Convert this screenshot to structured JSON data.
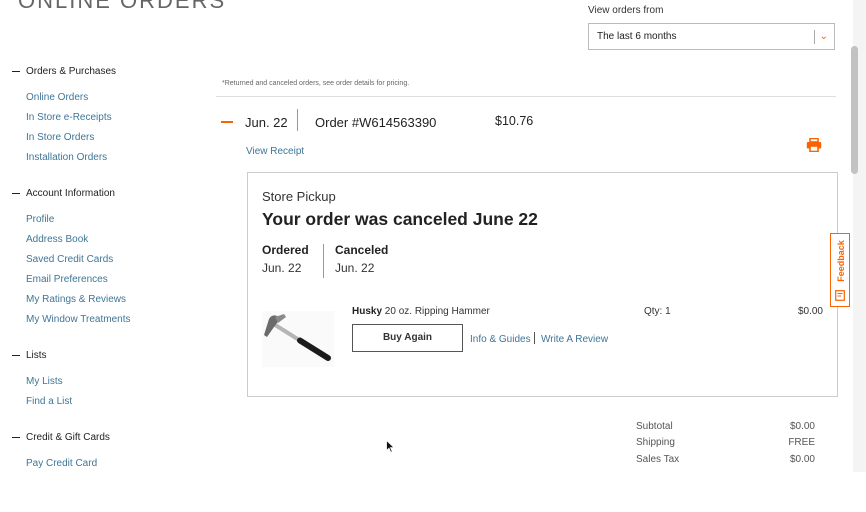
{
  "sidebar": {
    "sections": [
      {
        "title": "Orders & Purchases",
        "items": [
          "Online Orders",
          "In Store e-Receipts",
          "In Store Orders",
          "Installation Orders"
        ]
      },
      {
        "title": "Account Information",
        "items": [
          "Profile",
          "Address Book",
          "Saved Credit Cards",
          "Email Preferences",
          "My Ratings & Reviews",
          "My Window Treatments"
        ]
      },
      {
        "title": "Lists",
        "items": [
          "My Lists",
          "Find a List"
        ]
      },
      {
        "title": "Credit & Gift Cards",
        "items": [
          "Pay Credit Card"
        ]
      }
    ]
  },
  "filter": {
    "label": "View orders from",
    "selected": "The last 6 months"
  },
  "note": "*Returned and canceled orders, see order details for pricing.",
  "order": {
    "date": "Jun. 22",
    "number": "Order #W614563390",
    "total": "$10.76",
    "view_receipt": "View Receipt",
    "card": {
      "type": "Store Pickup",
      "headline": "Your order was canceled June 22",
      "ordered_label": "Ordered",
      "ordered_date": "Jun. 22",
      "canceled_label": "Canceled",
      "canceled_date": "Jun. 22",
      "item": {
        "brand": "Husky",
        "name": "20 oz. Ripping Hammer",
        "qty": "Qty: 1",
        "price": "$0.00",
        "buy_again": "Buy Again",
        "info_guides": "Info & Guides",
        "write_review": "Write A Review"
      }
    },
    "summary": [
      {
        "label": "Subtotal",
        "value": "$0.00"
      },
      {
        "label": "Shipping",
        "value": "FREE"
      },
      {
        "label": "Sales Tax",
        "value": "$0.00"
      }
    ]
  },
  "feedback": "Feedback",
  "colors": {
    "accent": "#f96302",
    "link": "#3e7697"
  }
}
